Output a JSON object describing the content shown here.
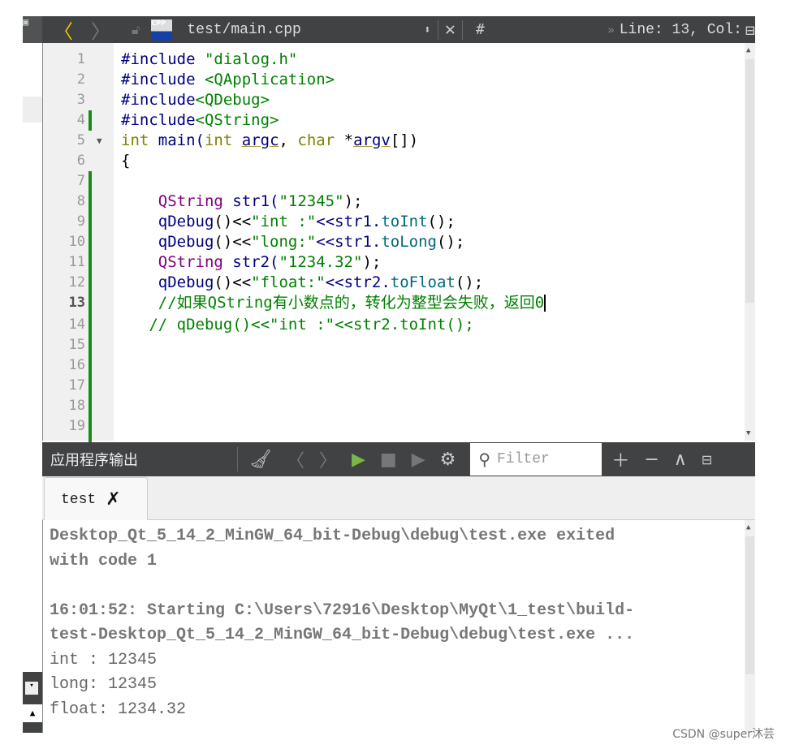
{
  "toolbar": {
    "file_name": "test/main.cpp",
    "file_icon_label": "CPP",
    "hash": "#",
    "line_col": "Line: 13, Col:",
    "icons": [
      "left-pane-icon",
      "back-arrow-icon",
      "forward-arrow-icon",
      "lock-icon",
      "cpp-file-icon",
      "updown-icon",
      "close-icon",
      "split-icon"
    ]
  },
  "editor": {
    "current_line": 13,
    "lines": [
      {
        "n": "1",
        "tokens": [
          [
            "#include ",
            "pp"
          ],
          [
            "\"dialog.h\"",
            "str"
          ]
        ]
      },
      {
        "n": "2",
        "tokens": [
          [
            "#include ",
            "pp"
          ],
          [
            "<QApplication>",
            "str"
          ]
        ]
      },
      {
        "n": "3",
        "tokens": [
          [
            "#include",
            "pp"
          ],
          [
            "<QDebug>",
            "str"
          ]
        ]
      },
      {
        "n": "4",
        "tokens": [
          [
            "#include",
            "pp"
          ],
          [
            "<QString>",
            "str"
          ]
        ]
      },
      {
        "n": "5",
        "tokens": [
          [
            "int",
            "kw"
          ],
          [
            " main(",
            "id"
          ],
          [
            "int",
            "kw"
          ],
          [
            " ",
            "pl"
          ],
          [
            "argc",
            "ul"
          ],
          [
            ", ",
            "pl"
          ],
          [
            "char",
            "kw"
          ],
          [
            " *",
            "pl"
          ],
          [
            "argv",
            "ul"
          ],
          [
            "[])",
            "pl"
          ]
        ]
      },
      {
        "n": "6",
        "tokens": [
          [
            "{",
            "pl"
          ]
        ]
      },
      {
        "n": "7",
        "tokens": []
      },
      {
        "n": "8",
        "tokens": [
          [
            "    ",
            "pl"
          ],
          [
            "QString",
            "ty"
          ],
          [
            " str1(",
            "id"
          ],
          [
            "\"12345\"",
            "str"
          ],
          [
            ");",
            "pl"
          ]
        ]
      },
      {
        "n": "9",
        "tokens": [
          [
            "    ",
            "pl"
          ],
          [
            "qDebug",
            "id"
          ],
          [
            "()<<",
            "pl"
          ],
          [
            "\"int :\"",
            "str"
          ],
          [
            "<<str1.",
            "id"
          ],
          [
            "toInt",
            "fn"
          ],
          [
            "();",
            "pl"
          ]
        ]
      },
      {
        "n": "10",
        "tokens": [
          [
            "    ",
            "pl"
          ],
          [
            "qDebug",
            "id"
          ],
          [
            "()<<",
            "pl"
          ],
          [
            "\"long:\"",
            "str"
          ],
          [
            "<<str1.",
            "id"
          ],
          [
            "toLong",
            "fn"
          ],
          [
            "();",
            "pl"
          ]
        ]
      },
      {
        "n": "11",
        "tokens": [
          [
            "    ",
            "pl"
          ],
          [
            "QString",
            "ty"
          ],
          [
            " str2(",
            "id"
          ],
          [
            "\"1234.32\"",
            "str"
          ],
          [
            ");",
            "pl"
          ]
        ]
      },
      {
        "n": "12",
        "tokens": [
          [
            "    ",
            "pl"
          ],
          [
            "qDebug",
            "id"
          ],
          [
            "()<<",
            "pl"
          ],
          [
            "\"float:\"",
            "str"
          ],
          [
            "<<str2.",
            "id"
          ],
          [
            "toFloat",
            "fn"
          ],
          [
            "();",
            "pl"
          ]
        ]
      },
      {
        "n": "13",
        "tokens": [
          [
            "    ",
            "pl"
          ],
          [
            "//如果QString有小数点的，转化为整型会失败，返回0",
            "cm"
          ]
        ]
      },
      {
        "n": "14",
        "tokens": [
          [
            "   ",
            "pl"
          ],
          [
            "// qDebug()<<\"int :\"<<str2.toInt();",
            "cm"
          ]
        ]
      },
      {
        "n": "15",
        "tokens": []
      },
      {
        "n": "16",
        "tokens": []
      },
      {
        "n": "17",
        "tokens": []
      },
      {
        "n": "18",
        "tokens": []
      },
      {
        "n": "19",
        "tokens": []
      }
    ]
  },
  "output_pane": {
    "title": "应用程序输出",
    "filter_placeholder": "Filter",
    "icons": [
      "clear-icon",
      "prev-icon",
      "next-icon",
      "run-icon",
      "stop-icon",
      "debug-run-icon",
      "settings-icon",
      "search-icon",
      "zoom-in-icon",
      "zoom-out-icon",
      "maximize-icon",
      "hide-icon"
    ],
    "tab_label": "test",
    "lines": [
      {
        "text": "Desktop_Qt_5_14_2_MinGW_64_bit-Debug\\debug\\test.exe exited",
        "bold": true
      },
      {
        "text": "with code 1",
        "bold": true
      },
      {
        "text": "",
        "bold": false
      },
      {
        "text": "16:01:52: Starting C:\\Users\\72916\\Desktop\\MyQt\\1_test\\build-",
        "bold": true
      },
      {
        "text": "test-Desktop_Qt_5_14_2_MinGW_64_bit-Debug\\debug\\test.exe ...",
        "bold": true
      },
      {
        "text": "int : 12345",
        "bold": false
      },
      {
        "text": "long: 12345",
        "bold": false
      },
      {
        "text": "float: 1234.32",
        "bold": false
      }
    ]
  },
  "watermark": "CSDN @super沐芸",
  "colors": {
    "toolbar_bg": "#404244",
    "run_green": "#7ab648",
    "change_marker": "#1a8a1a"
  }
}
